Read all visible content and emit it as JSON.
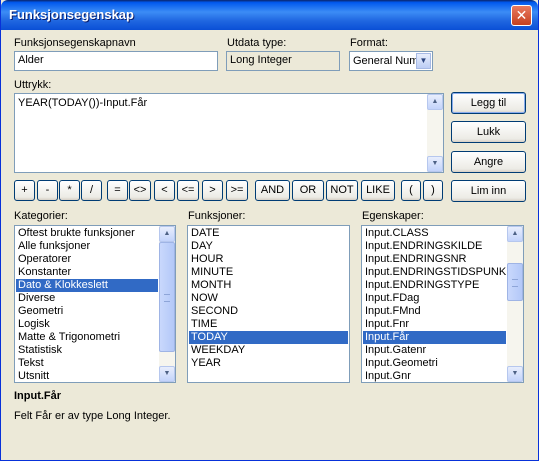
{
  "window": {
    "title": "Funksjonsegenskap",
    "close_glyph": "✕"
  },
  "name_field": {
    "label": "Funksjonsegenskapnavn",
    "value": "Alder"
  },
  "output_type": {
    "label": "Utdata type:",
    "value": "Long Integer"
  },
  "format": {
    "label": "Format:",
    "value": "General Num"
  },
  "expression": {
    "label": "Uttrykk:",
    "value": "YEAR(TODAY())-Input.Får"
  },
  "buttons": {
    "insert": "Legg til",
    "close": "Lukk",
    "undo": "Angre",
    "paste": "Lim inn"
  },
  "operators": [
    "+",
    "-",
    "*",
    "/",
    "=",
    "<>",
    "<",
    "<=",
    ">",
    ">=",
    "AND",
    "OR",
    "NOT",
    "LIKE",
    "(",
    ")"
  ],
  "categories": {
    "label": "Kategorier:",
    "items": [
      "Oftest brukte funksjoner",
      "Alle funksjoner",
      "Operatorer",
      "Konstanter",
      "Dato & Klokkeslett",
      "Diverse",
      "Geometri",
      "Logisk",
      "Matte & Trigonometri",
      "Statistisk",
      "Tekst",
      "Utsnitt"
    ],
    "selected_index": 4
  },
  "functions": {
    "label": "Funksjoner:",
    "items": [
      "DATE",
      "DAY",
      "HOUR",
      "MINUTE",
      "MONTH",
      "NOW",
      "SECOND",
      "TIME",
      "TODAY",
      "WEEKDAY",
      "YEAR"
    ],
    "selected_index": 8
  },
  "properties": {
    "label": "Egenskaper:",
    "items": [
      "Input.CLASS",
      "Input.ENDRINGSKILDE",
      "Input.ENDRINGSNR",
      "Input.ENDRINGSTIDSPUNKT",
      "Input.ENDRINGSTYPE",
      "Input.FDag",
      "Input.FMnd",
      "Input.Fnr",
      "Input.Får",
      "Input.Gatenr",
      "Input.Geometri",
      "Input.Gnr"
    ],
    "selected_index": 8
  },
  "description": {
    "title": "Input.Får",
    "text": "Felt Får er av type Long Integer."
  },
  "colors": {
    "selection": "#316ac5",
    "dialog_bg": "#ece9d8",
    "titlebar": "#0058ee"
  }
}
